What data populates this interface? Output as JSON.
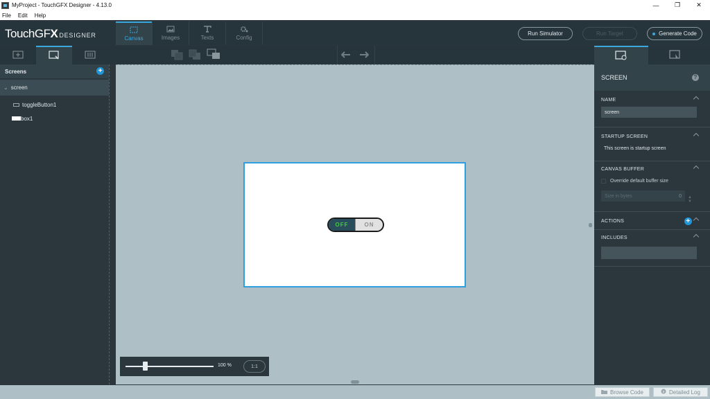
{
  "window": {
    "title": "MyProject - TouchGFX Designer - 4.13.0",
    "minimize": "—",
    "restore": "❐",
    "close": "✕"
  },
  "menu": [
    "File",
    "Edit",
    "Help"
  ],
  "header": {
    "logo_main": "TouchGF",
    "logo_x": "X",
    "logo_sub": "DESIGNER",
    "tabs": [
      {
        "label": "Canvas",
        "icon": "canvas-icon",
        "active": true
      },
      {
        "label": "Images",
        "icon": "image-icon",
        "active": false
      },
      {
        "label": "Texts",
        "icon": "text-icon",
        "active": false
      },
      {
        "label": "Config",
        "icon": "gear-icon",
        "active": false
      }
    ],
    "run_simulator": "Run Simulator",
    "run_target": "Run Target",
    "generate_code": "Generate Code"
  },
  "toolbar": {
    "left_tabs": [
      "add-widget-icon",
      "screens-tree-icon",
      "mixins-icon"
    ],
    "center_icons": [
      "bring-forward-icon",
      "send-backward-icon",
      "align-icon"
    ],
    "history": [
      "undo-icon",
      "redo-icon"
    ],
    "right_tabs": [
      "properties-icon",
      "interactions-icon"
    ]
  },
  "screens_panel": {
    "title": "Screens",
    "screen_name": "screen",
    "children": [
      {
        "label": "toggleButton1",
        "icon": "toggle-button-icon"
      },
      {
        "label": "box1",
        "icon": "box-icon"
      }
    ]
  },
  "canvas": {
    "toggle_off": "OFF",
    "toggle_on": "ON",
    "zoom_value": "100 %",
    "zoom_fraction": 0.23,
    "zoom_reset": "1:1"
  },
  "properties": {
    "title": "SCREEN",
    "help": "?",
    "name_label": "NAME",
    "name_value": "screen",
    "startup_label": "STARTUP SCREEN",
    "startup_text": "This screen is startup screen",
    "canvas_buffer_label": "CANVAS BUFFER",
    "override_label": "Override default buffer size",
    "size_placeholder": "Size in bytes",
    "size_value": "0",
    "actions_label": "ACTIONS",
    "includes_label": "INCLUDES"
  },
  "statusbar": {
    "browse_code": "Browse Code",
    "detailed_log": "Detailed Log"
  },
  "colors": {
    "accent": "#3aa9e0",
    "toggle_off_bg": "#2a4d5b",
    "toggle_off_text": "#46c84a"
  }
}
